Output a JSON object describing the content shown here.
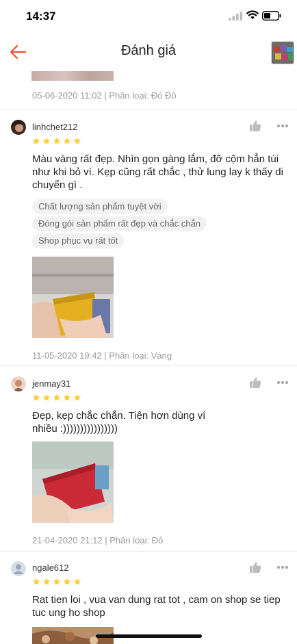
{
  "status_bar": {
    "time": "14:37"
  },
  "header": {
    "title": "Đánh giá"
  },
  "top_partial": {
    "meta": "05-06-2020 11:02 | Phân loại: Đỏ Đô"
  },
  "reviews": [
    {
      "username": "linhchet212",
      "rating": 5,
      "text": "Màu vàng rất đẹp. Nhìn gọn gàng lắm, đỡ cộm hẳn túi như khi bỏ ví. Kẹp cũng rất chắc , thử lung lay k thấy di chuyển gì .",
      "tags": [
        "Chất lượng sản phẩm tuyệt vời",
        "Đóng gói sản phẩm rất đẹp và chắc chắn",
        "Shop phục vụ rất tốt"
      ],
      "meta": "11-05-2020 19:42 | Phân loại: Vàng"
    },
    {
      "username": "jenmay31",
      "rating": 5,
      "text": "Đẹp, kẹp chắc chắn. Tiện hơn dùng ví nhiều :))))))))))))))))",
      "tags": [],
      "meta": "21-04-2020 21:12 | Phân loại: Đỏ"
    },
    {
      "username": "ngale612",
      "rating": 5,
      "text": "Rat tien loi , vua van dung rat tot , cam on shop se tiep tuc ung ho shop",
      "tags": [],
      "meta": ""
    }
  ],
  "colors": {
    "accent": "#ee4d2d",
    "star": "#ffce3d",
    "meta": "#9a9a9a",
    "tag_bg": "#f2f2f2"
  },
  "icons": [
    "signal-icon",
    "wifi-icon",
    "battery-icon",
    "back-arrow-icon",
    "thumbs-up-icon",
    "more-icon",
    "star-icon"
  ]
}
